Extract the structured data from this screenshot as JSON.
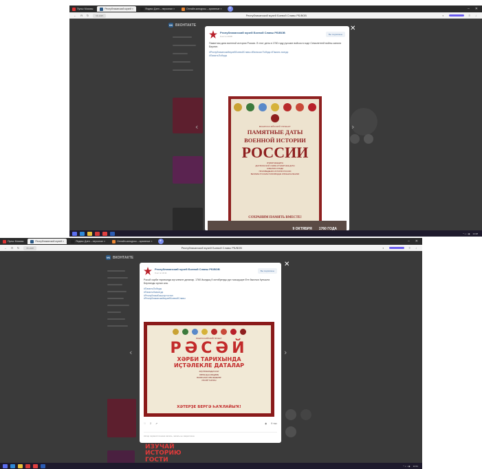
{
  "shot1": {
    "tabs": [
      "Пульс Москвы",
      "Республиканский музей ×",
      "Яндекс Дзен – персонал ×",
      "Онлайн-конкурсы – архивные ×"
    ],
    "page_title": "Республиканский музей Боевой Славы РБ/ВОВ",
    "url": "vk.com",
    "vk_brand": "ВКОНТАКТЕ",
    "post": {
      "author": "Республиканский музей Боевой Славы РБ/ВОВ",
      "date": "9 окт в 10:08",
      "subscribe": "Вы подписаны",
      "text": "Памятная дата военной истории России. В этот день в 1760 году русские войска в ходе Семилетней войны заняли Берлин.",
      "tags": [
        "#РеспубликанскиймузейБоевойСлавы #Великая Победа #Память всегда",
        "#ПамятьПобеды"
      ],
      "poster": {
        "subtitle": "ВСЕРОССИЙСКИЙ ПРОЕКТ",
        "title_line1": "ПАМЯТНЫЕ ДАТЫ",
        "title_line2": "ВОЕННОЙ ИСТОРИИ",
        "title_big": "РОССИИ",
        "small_lines": [
          "#ПАМЯТНЫЕДАТЫ",
          "ДНИ ВОИНСКОЙ СЛАВЫ И ПАМЯТНЫЕ ДАТЫ",
          "СОБЫТИЯ И ЛЮДИ",
          "ПРОИЗВЕДЕНИЯ ИСТОРИИ РОССИИ",
          "ВЕЛИКИЕ РУССКИЕ ПОЛКОВОДЦЫ И ВОЕНАЧАЛЬНИКИ"
        ],
        "footer": "СОХРАНИМ ПАМЯТЬ ВМЕСТЕ!"
      },
      "banner_date": "9 ОКТЯБРЯ",
      "banner_year": "1760 ГОДА"
    },
    "taskbar_time": "14:28"
  },
  "shot2": {
    "tabs": [
      "Пульс Москвы",
      "Республиканский музей ×",
      "Яндекс Дзен – персонал ×",
      "Онлайн-конкурсы – архивные ×"
    ],
    "page_title": "Республиканский музей Боевой Славы РБ/ВОВ",
    "url": "vk.com",
    "vk_brand": "ВКОНТАКТЕ",
    "post": {
      "author": "Республиканский музей Боевой Славы РБ/ВОВ",
      "date": "9 окт в 10:11",
      "subscribe": "Вы подписаны",
      "text": "Рәсәй хәрби тарихында иҫтәлекле даталар. 1760 йылдың 9 октябрендә рус ғәскәрҙәре Ете йыллыҡ һуғышта Берлинды яулап ала.",
      "tags": [
        "#ПамятьПобеды",
        "#ПамятьНавсегда",
        "#РеспубликаБашкортостан",
        "#РеспубликанскиймузейБоевойСлавы"
      ],
      "poster": {
        "subtitle": "ВСЕРОССИЙСКИЙ ПРОЕКТ",
        "title_big": "РӘСӘЙ",
        "title_line1": "ХӘРБИ ТАРИХЫНДА",
        "title_line2": "ИҪТӘЛЕКЛЕ ДАТАЛАР",
        "small_lines": [
          "#ИҪТӘЛЕКЛЕДАТАЛАР",
          "ХӘРБИ ДАН КӨНДӘРЕ",
          "ВАҠИҒАЛАР ҺӘМ КЕШЕЛӘР",
          "РӘСӘЙ ТАРИХЫ"
        ],
        "footer": "ХӘТЕРҘЕ БЕРГӘ ҺАҠЛАЙЫҠ!"
      },
      "likes": "2",
      "views": "9 тыс",
      "note": "Автор первоисточника запись, запись не закреплена"
    },
    "promo": [
      "ИЗУЧАЙ",
      "ИСТОРИЮ",
      "ГОСТИ"
    ],
    "taskbar_time": "14:31"
  }
}
